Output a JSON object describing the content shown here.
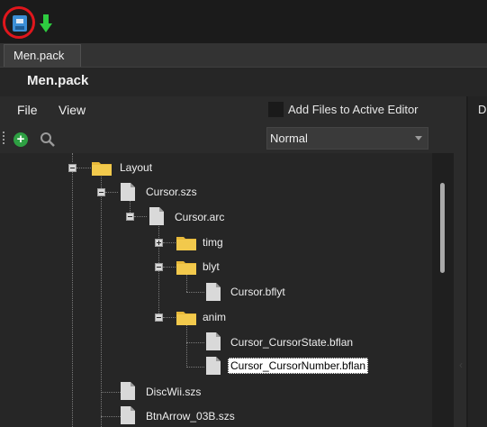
{
  "toolbar": {
    "save_icon": "save-icon",
    "import_icon": "down-arrow-icon",
    "highlight_color": "#e0161c"
  },
  "tabs": [
    {
      "label": "Men.pack"
    }
  ],
  "document": {
    "title": "Men.pack"
  },
  "menu": {
    "items": [
      {
        "label": "File"
      },
      {
        "label": "View"
      }
    ]
  },
  "options": {
    "add_files_label": "Add Files to Active Editor",
    "add_files_checked": false,
    "filter_select_value": "Normal"
  },
  "right_panel": {
    "partial_label": "D"
  },
  "tree": {
    "nodes": [
      {
        "label": "Layout",
        "type": "folder",
        "expanded": true
      },
      {
        "label": "Cursor.szs",
        "type": "file",
        "expanded": true
      },
      {
        "label": "Cursor.arc",
        "type": "file",
        "expanded": true
      },
      {
        "label": "timg",
        "type": "folder",
        "expanded": false
      },
      {
        "label": "blyt",
        "type": "folder",
        "expanded": true
      },
      {
        "label": "Cursor.bflyt",
        "type": "file"
      },
      {
        "label": "anim",
        "type": "folder",
        "expanded": true
      },
      {
        "label": "Cursor_CursorState.bflan",
        "type": "file"
      },
      {
        "label": "Cursor_CursorNumber.bflan",
        "type": "file",
        "selected": true
      },
      {
        "label": "DiscWii.szs",
        "type": "file"
      },
      {
        "label": "BtnArrow_03B.szs",
        "type": "file"
      }
    ]
  }
}
